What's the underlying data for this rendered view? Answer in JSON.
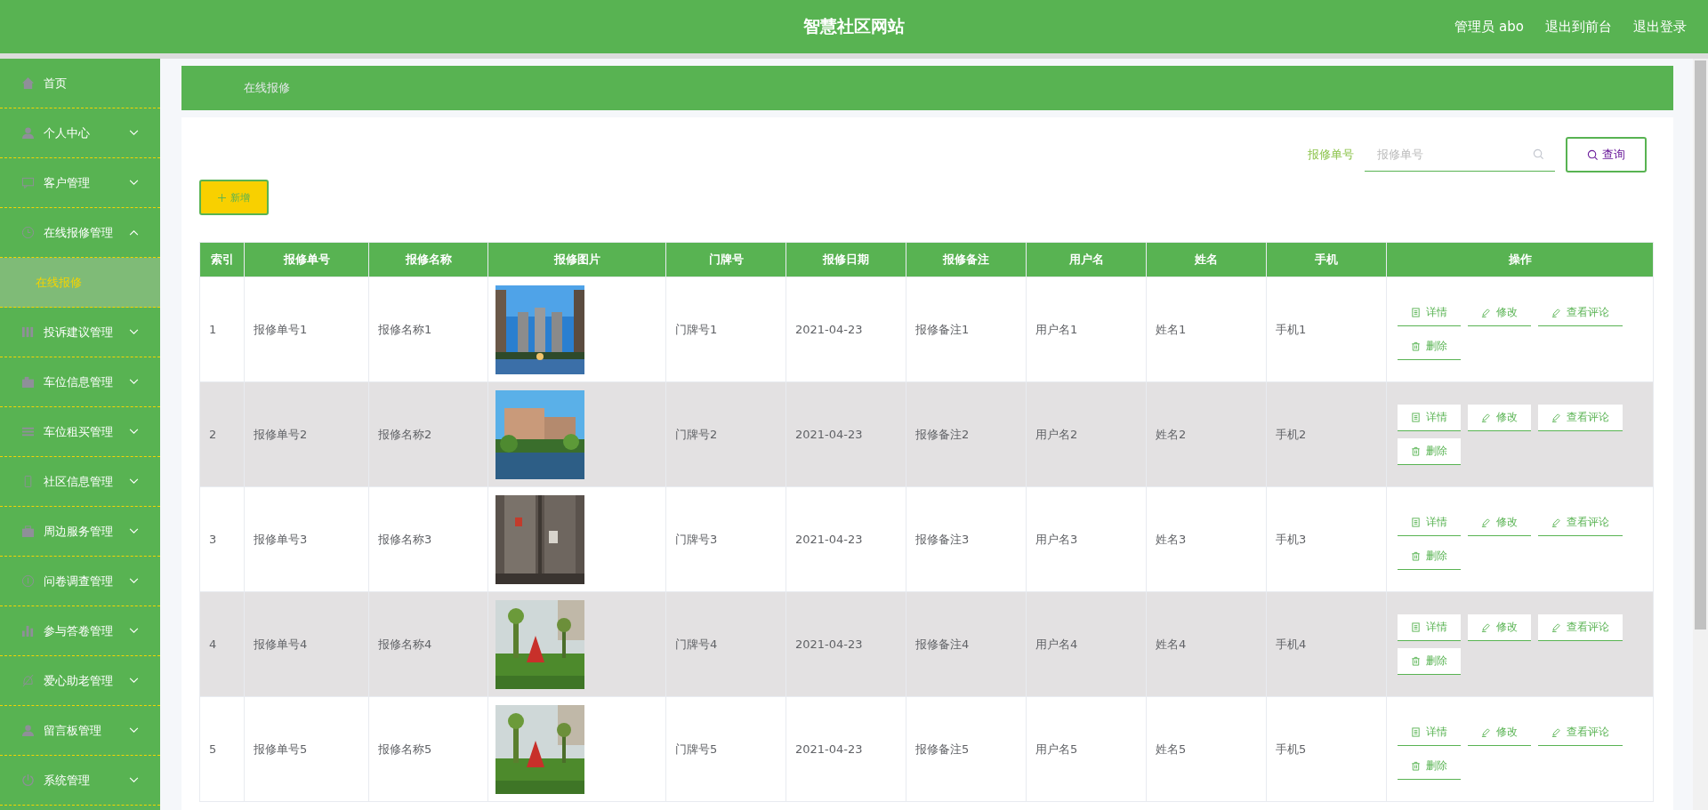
{
  "header": {
    "title": "智慧社区网站",
    "links": [
      "管理员 abo",
      "退出到前台",
      "退出登录"
    ]
  },
  "sidebar": {
    "items": [
      {
        "label": "首页",
        "kind": "link"
      },
      {
        "label": "个人中心",
        "kind": "group",
        "expanded": false
      },
      {
        "label": "客户管理",
        "kind": "group",
        "expanded": false
      },
      {
        "label": "在线报修管理",
        "kind": "group",
        "expanded": true,
        "children": [
          {
            "label": "在线报修",
            "selected": true
          }
        ]
      },
      {
        "label": "投诉建议管理",
        "kind": "group",
        "expanded": false
      },
      {
        "label": "车位信息管理",
        "kind": "group",
        "expanded": false
      },
      {
        "label": "车位租买管理",
        "kind": "group",
        "expanded": false
      },
      {
        "label": "社区信息管理",
        "kind": "group",
        "expanded": false
      },
      {
        "label": "周边服务管理",
        "kind": "group",
        "expanded": false
      },
      {
        "label": "问卷调查管理",
        "kind": "group",
        "expanded": false
      },
      {
        "label": "参与答卷管理",
        "kind": "group",
        "expanded": false
      },
      {
        "label": "爱心助老管理",
        "kind": "group",
        "expanded": false
      },
      {
        "label": "留言板管理",
        "kind": "group",
        "expanded": false
      },
      {
        "label": "系统管理",
        "kind": "group",
        "expanded": false
      }
    ]
  },
  "breadcrumb": "在线报修",
  "search": {
    "label": "报修单号",
    "placeholder": "报修单号",
    "button": "查询"
  },
  "add_button": "新增",
  "table": {
    "columns": [
      "索引",
      "报修单号",
      "报修名称",
      "报修图片",
      "门牌号",
      "报修日期",
      "报修备注",
      "用户名",
      "姓名",
      "手机",
      "操作"
    ],
    "rows": [
      {
        "cells": [
          "1",
          "报修单号1",
          "报修名称1",
          {
            "kind": "picture"
          },
          "门牌号1",
          "2021-04-23",
          "报修备注1",
          "用户名1",
          "姓名1",
          "手机1"
        ],
        "actions": [
          "详情",
          "修改",
          "查看评论",
          "删除"
        ]
      },
      {
        "cells": [
          "2",
          "报修单号2",
          "报修名称2",
          {
            "kind": "picture"
          },
          "门牌号2",
          "2021-04-23",
          "报修备注2",
          "用户名2",
          "姓名2",
          "手机2"
        ],
        "actions": [
          "详情",
          "修改",
          "查看评论",
          "删除"
        ]
      },
      {
        "cells": [
          "3",
          "报修单号3",
          "报修名称3",
          {
            "kind": "picture"
          },
          "门牌号3",
          "2021-04-23",
          "报修备注3",
          "用户名3",
          "姓名3",
          "手机3"
        ],
        "actions": [
          "详情",
          "修改",
          "查看评论",
          "删除"
        ]
      },
      {
        "cells": [
          "4",
          "报修单号4",
          "报修名称4",
          {
            "kind": "picture"
          },
          "门牌号4",
          "2021-04-23",
          "报修备注4",
          "用户名4",
          "姓名4",
          "手机4"
        ],
        "actions": [
          "详情",
          "修改",
          "查看评论",
          "删除"
        ]
      },
      {
        "cells": [
          "5",
          "报修单号5",
          "报修名称5",
          {
            "kind": "picture"
          },
          "门牌号5",
          "2021-04-23",
          "报修备注5",
          "用户名5",
          "姓名5",
          "手机5"
        ],
        "actions": [
          "详情",
          "修改",
          "查看评论",
          "删除"
        ]
      }
    ]
  }
}
